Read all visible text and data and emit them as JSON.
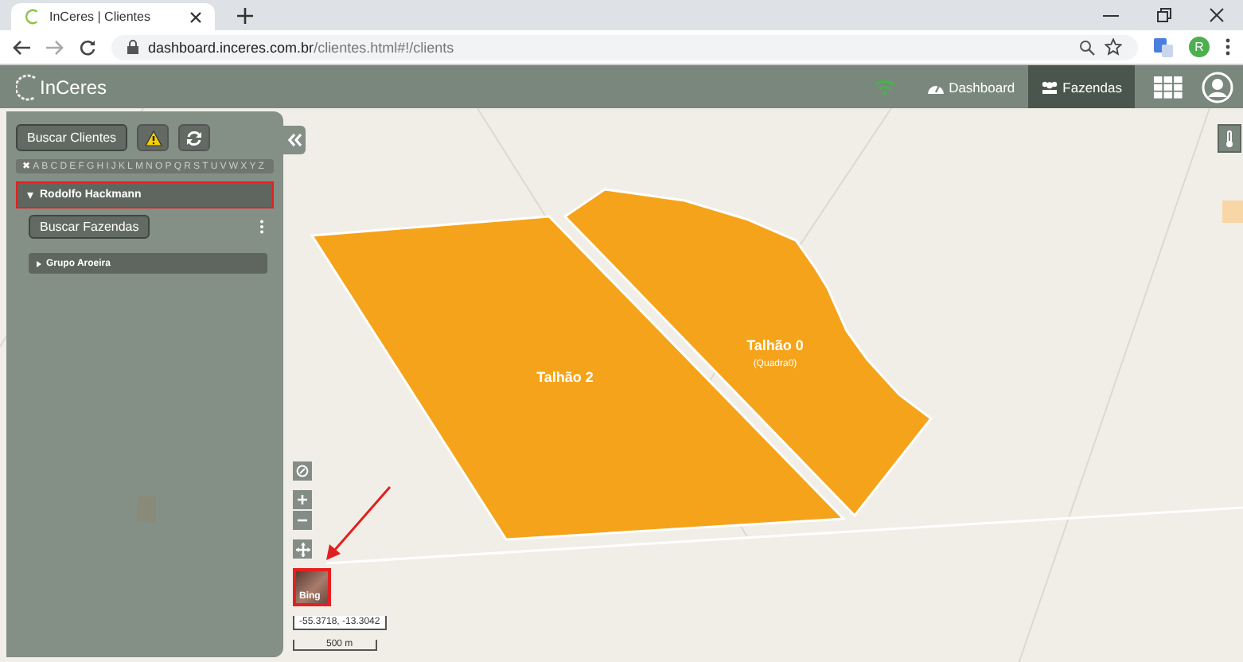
{
  "browser": {
    "tab_title": "InCeres | Clientes",
    "url_domain": "dashboard.inceres.com.br",
    "url_path": "/clientes.html#!/clients",
    "profile_initial": "R"
  },
  "app": {
    "logo": "InCeres",
    "nav": [
      {
        "label": "Dashboard",
        "kind": "gauge",
        "selected": false
      },
      {
        "label": "Fazendas",
        "kind": "users",
        "selected": true
      }
    ]
  },
  "sidebar": {
    "search_button": "Buscar Clientes",
    "letters": [
      "✖",
      "A",
      "B",
      "C",
      "D",
      "E",
      "F",
      "G",
      "H",
      "I",
      "J",
      "K",
      "L",
      "M",
      "N",
      "O",
      "P",
      "Q",
      "R",
      "S",
      "T",
      "U",
      "V",
      "W",
      "X",
      "Y",
      "Z"
    ],
    "clients": [
      {
        "name": "Rodolfo Hackmann",
        "expanded": true,
        "highlighted": true,
        "search_farms_button": "Buscar Fazendas",
        "groups": [
          {
            "name": "Grupo Aroeira",
            "expanded": false
          }
        ]
      }
    ]
  },
  "map": {
    "fields": [
      {
        "label": "Talhão 2"
      },
      {
        "label": "Talhão 0",
        "sublabel": "(Quadra0)"
      }
    ],
    "basemap": {
      "label": "Bing",
      "highlighted": true
    },
    "coordinates": "-55.3718, -13.3042",
    "scale": "500 m"
  }
}
